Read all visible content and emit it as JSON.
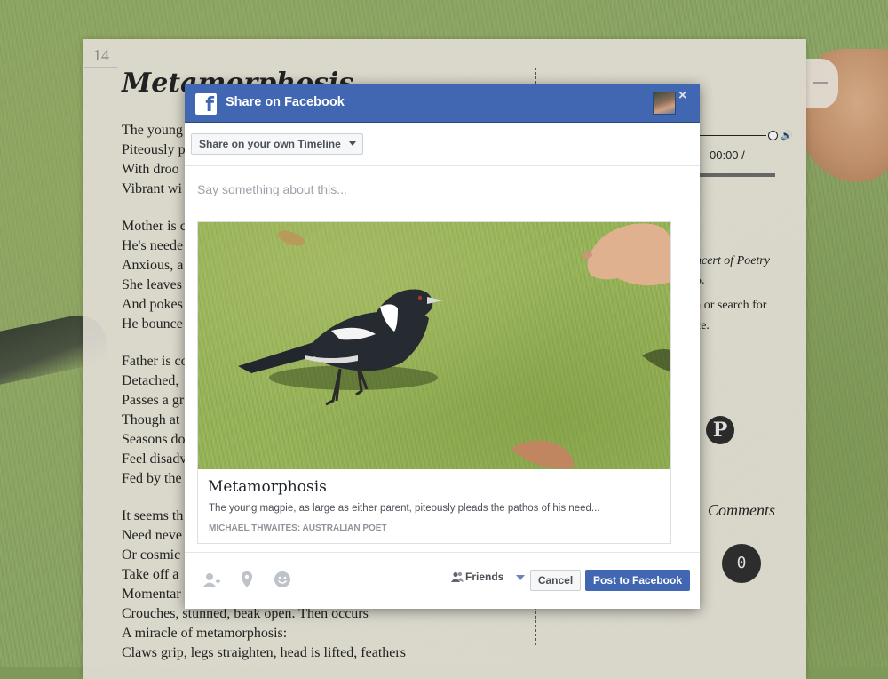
{
  "page": {
    "number": "14",
    "title": "Metamorphosis",
    "lines": [
      "The young",
      "Piteously p",
      "With droo",
      "Vibrant wi",
      "",
      "Mother is c",
      "He's neede",
      "Anxious, a",
      "She leaves",
      "And pokes",
      "He bounce",
      "",
      "Father is co",
      "Detached,",
      "Passes a gr",
      "Though at",
      "Seasons do",
      "Feel disadv",
      "Fed by the",
      "",
      "It seems th",
      "Need neve",
      "Or cosmic",
      "Take off a",
      "Momentar",
      "Crouches, stunned, beak open. Then occurs",
      "A miracle of metamorphosis:",
      "Claws grip, legs straighten, head is lifted, feathers"
    ]
  },
  "right_col": {
    "audio_time": "00:00 /",
    "concert": "ncert of Poetry",
    "year": "5.",
    "search_red": "a",
    "search_rest": " or search for",
    "search_tail": "ce.",
    "pinterest_glyph": "P",
    "comments_label": "Comments",
    "comments_count": "0"
  },
  "dialog": {
    "title": "Share on Facebook",
    "close": "×",
    "fb_letter": "f",
    "audience": "Share on your own Timeline",
    "message_placeholder": "Say something about this...",
    "card": {
      "title": "Metamorphosis",
      "description": "The young magpie, as large as either parent, piteously pleads the pathos of his need...",
      "domain": "MICHAEL THWAITES: AUSTRALIAN POET"
    },
    "footer": {
      "icons": [
        "tag-friends-icon",
        "location-pin-icon",
        "emoji-icon"
      ],
      "privacy": "Friends",
      "cancel": "Cancel",
      "post": "Post to Facebook"
    }
  },
  "colors": {
    "facebook_blue": "#4267b2",
    "grass": "#8aa463"
  }
}
